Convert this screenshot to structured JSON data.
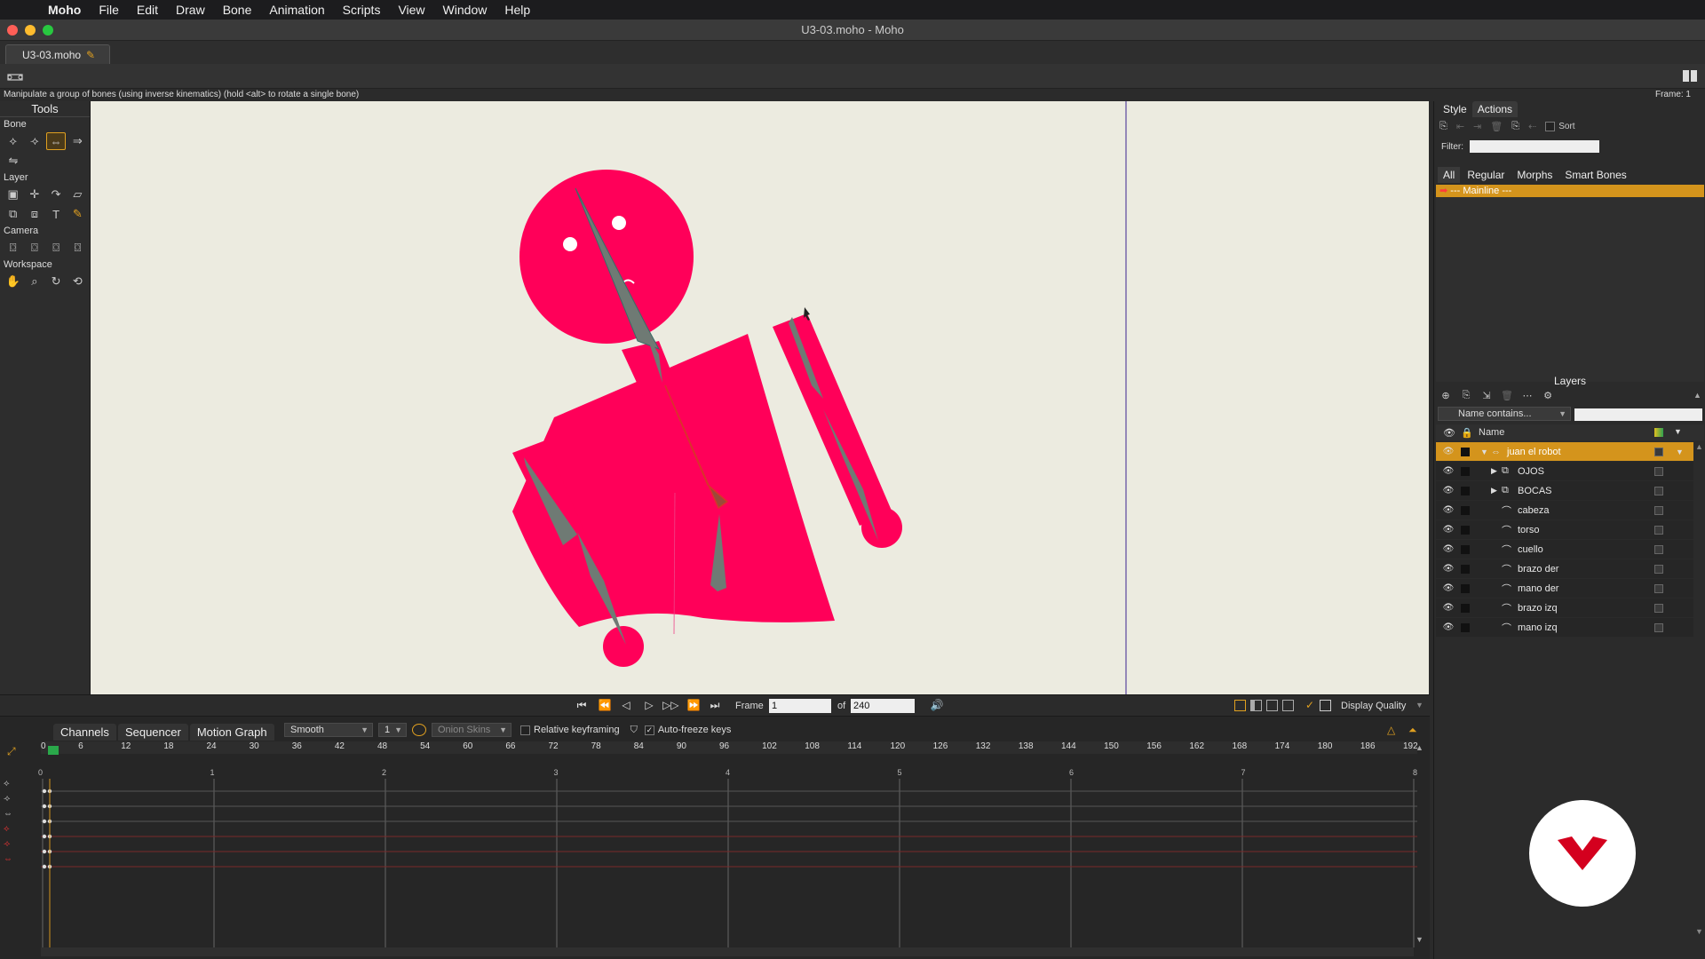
{
  "menubar": {
    "app": "Moho",
    "items": [
      "File",
      "Edit",
      "Draw",
      "Bone",
      "Animation",
      "Scripts",
      "View",
      "Window",
      "Help"
    ]
  },
  "window": {
    "title": "U3-03.moho - Moho",
    "doc_tab": "U3-03.moho"
  },
  "status": {
    "hint": "Manipulate a group of bones (using inverse kinematics) (hold <alt> to rotate a single bone)",
    "frame": "Frame: 1"
  },
  "tools": {
    "title": "Tools",
    "sections": {
      "bone": "Bone",
      "layer": "Layer",
      "camera": "Camera",
      "workspace": "Workspace"
    },
    "icons": {
      "bone": [
        "select-bone-icon",
        "translate-bone-icon",
        "manipulate-bones-icon",
        "add-bone-icon",
        "bone-strength-icon"
      ],
      "layer": [
        "set-origin-icon",
        "translate-layer-icon",
        "rotate-layer-icon",
        "shear-layer-icon",
        "scale-layer-icon",
        "flip-layer-icon",
        "text-icon",
        "eyedropper-icon"
      ],
      "camera": [
        "track-camera-icon",
        "zoom-camera-icon",
        "roll-camera-icon",
        "pan-tilt-camera-icon"
      ],
      "workspace": [
        "hand-icon",
        "zoom-icon",
        "rotate-workspace-icon",
        "orbit-icon"
      ]
    }
  },
  "character": {
    "body_color": "#ff0059",
    "bone_color": "#6f7a74",
    "selected_bone_color": "#d8342a",
    "canvas_bg": "#ecebe0"
  },
  "playback": {
    "frame_label": "Frame",
    "frame_value": "1",
    "of_label": "of",
    "total_frames": "240",
    "display_quality": "Display Quality"
  },
  "timeline": {
    "tabs": [
      "Channels",
      "Sequencer",
      "Motion Graph"
    ],
    "interp": "Smooth",
    "interp_value": "1",
    "onion_skins": "Onion Skins",
    "relative_keyframing": "Relative keyframing",
    "auto_freeze": "Auto-freeze keys",
    "ruler_frames": [
      "0",
      "6",
      "12",
      "18",
      "24",
      "30",
      "36",
      "42",
      "48",
      "54",
      "60",
      "66",
      "72",
      "78",
      "84",
      "90",
      "96",
      "102",
      "108",
      "114",
      "120",
      "126",
      "132",
      "138",
      "144",
      "150",
      "156",
      "162",
      "168",
      "174",
      "180",
      "186",
      "192"
    ],
    "seconds": [
      "0",
      "1",
      "2",
      "3",
      "4",
      "5",
      "6",
      "7",
      "8"
    ]
  },
  "right_panel": {
    "tabs": [
      "Style",
      "Actions"
    ],
    "sort_label": "Sort",
    "filter_label": "Filter:",
    "action_tabs": [
      "All",
      "Regular",
      "Morphs",
      "Smart Bones"
    ],
    "mainline": "--- Mainline ---",
    "layers_title": "Layers",
    "name_filter": "Name contains...",
    "col_name": "Name",
    "layers": [
      {
        "name": "juan el robot",
        "depth": 0,
        "type": "bone",
        "expanded": true,
        "selected": true
      },
      {
        "name": "OJOS",
        "depth": 1,
        "type": "switch",
        "expanded": false
      },
      {
        "name": "BOCAS",
        "depth": 1,
        "type": "switch",
        "expanded": false
      },
      {
        "name": "cabeza",
        "depth": 1,
        "type": "vector"
      },
      {
        "name": "torso",
        "depth": 1,
        "type": "vector"
      },
      {
        "name": "cuello",
        "depth": 1,
        "type": "vector"
      },
      {
        "name": "brazo der",
        "depth": 1,
        "type": "vector"
      },
      {
        "name": "mano der",
        "depth": 1,
        "type": "vector"
      },
      {
        "name": "brazo izq",
        "depth": 1,
        "type": "vector"
      },
      {
        "name": "mano izq",
        "depth": 1,
        "type": "vector"
      }
    ]
  },
  "colors": {
    "accent": "#d4941c",
    "logo_red": "#d4001e"
  }
}
